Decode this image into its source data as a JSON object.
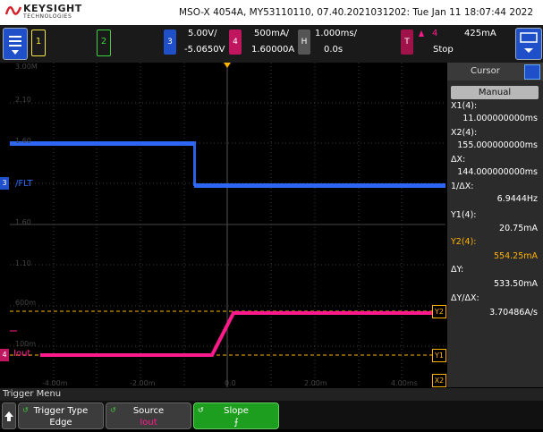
{
  "header": {
    "brand": "KEYSIGHT",
    "brand_sub": "TECHNOLOGIES",
    "instrument": "MSO-X 4054A, MY53110110, 07.40.2021031202: Tue Jan 11 18:07:44 2022"
  },
  "channels": {
    "ch1_label": "1",
    "ch2_label": "2",
    "ch3": {
      "label": "3",
      "scale": "5.00V/",
      "offset": "-5.0650V"
    },
    "ch4": {
      "label": "4",
      "scale": "500mA/",
      "offset": "1.60000A"
    },
    "horizontal": {
      "label": "H",
      "scale": "1.000ms/",
      "delay": "0.0s"
    },
    "trigger": {
      "label": "T",
      "source": "4",
      "level": "425mA",
      "state": "Stop"
    }
  },
  "grid_labels": {
    "left": [
      "3.00M",
      "2.10",
      "1.60",
      "/FLT",
      "1.60",
      "1.10",
      "600m",
      "100m"
    ],
    "bottom": [
      "-4.00m",
      "-2.00m",
      "0.0",
      "2.00m",
      "4.00ms"
    ],
    "markers": {
      "ch3": "3",
      "ch4": "4",
      "iout": "Iout",
      "y1": "Y1",
      "y2": "Y2",
      "x2": "X2"
    }
  },
  "cursor_panel": {
    "title": "Cursor",
    "mode": "Manual",
    "x1_label": "X1(4):",
    "x1_value": "11.000000000ms",
    "x2_label": "X2(4):",
    "x2_value": "155.000000000ms",
    "dx_label": "ΔX:",
    "dx_value": "144.000000000ms",
    "inv_dx_label": "1/ΔX:",
    "inv_dx_value": "6.9444Hz",
    "y1_label": "Y1(4):",
    "y1_value": "20.75mA",
    "y2_label": "Y2(4):",
    "y2_value": "554.25mA",
    "dy_label": "ΔY:",
    "dy_value": "533.50mA",
    "dydx_label": "ΔY/ΔX:",
    "dydx_value": "3.70486A/s"
  },
  "menu": {
    "title": "Trigger Menu",
    "softkeys": [
      {
        "l1": "Trigger Type",
        "l2": "Edge"
      },
      {
        "l1": "Source",
        "l2": "Iout"
      },
      {
        "l1": "Slope",
        "l2": "⨍"
      }
    ]
  },
  "colors": {
    "ch1": "#f5e642",
    "ch2": "#3fd13f",
    "ch3": "#2f6bff",
    "ch4": "#ff1a8c",
    "cursor": "#ffb300",
    "softkey_active": "#1e9e1e"
  }
}
